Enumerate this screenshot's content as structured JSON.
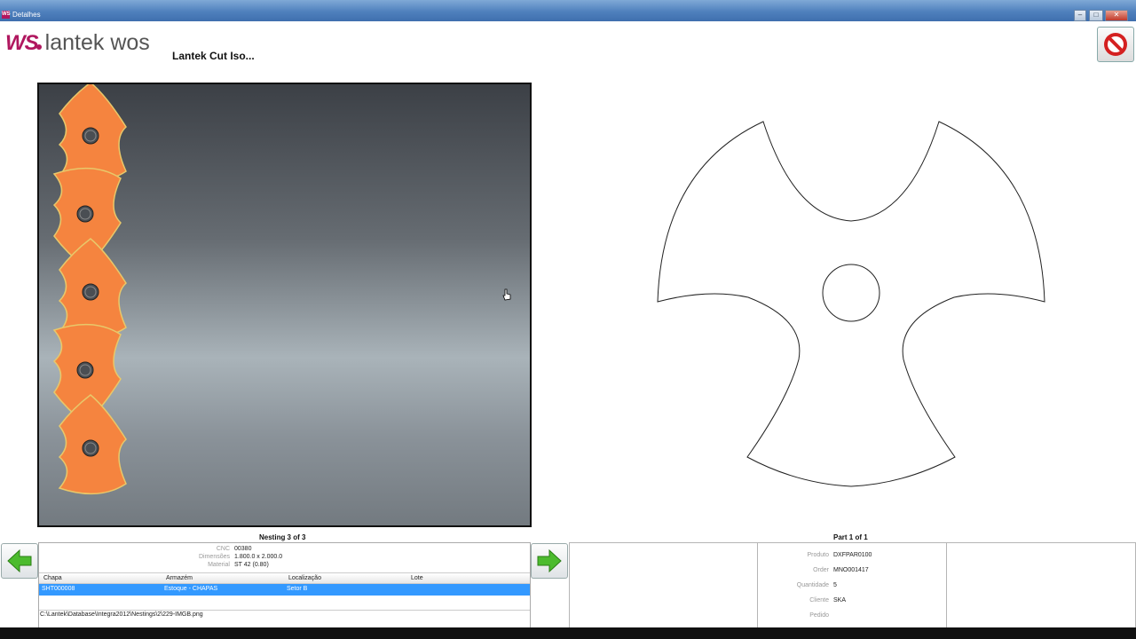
{
  "window": {
    "title": "Detalhes",
    "app_icon_text": "WS"
  },
  "header": {
    "logo_ws": "WS",
    "logo_brand": "lantek wos",
    "module_title": "Lantek Cut Iso..."
  },
  "icons": {
    "stop": "stop-icon",
    "prev": "arrow-left-icon",
    "next": "arrow-right-icon",
    "cursor": "hand-cursor-icon"
  },
  "colors": {
    "part_fill": "#f5843f",
    "part_stroke": "#e8c86a",
    "logo": "#b0175f",
    "selection": "#3399ff"
  },
  "nesting": {
    "caption": "Nesting 3 of 3",
    "cnc_label": "CNC",
    "cnc_value": "00380",
    "dim_label": "Dimensões",
    "dim_value": "1.800.0 x 2.000.0",
    "material_label": "Material",
    "material_value": "ST 42 (0.80)",
    "columns": [
      "Chapa",
      "Armazém",
      "Localização",
      "Lote"
    ],
    "row": {
      "chapa": "SHT000008",
      "armazem": "Estoque - CHAPAS",
      "localizacao": "Setor B",
      "lote": ""
    },
    "path": "C:\\Lantek\\Database\\Integra2012\\Nestings\\2\\229-IMGB.png"
  },
  "part": {
    "caption": "Part 1 of 1",
    "produto_label": "Produto",
    "produto_value": "DXFPAR0100",
    "order_label": "Order",
    "order_value": "MNO001417",
    "quantidade_label": "Quantidade",
    "quantidade_value": "5",
    "cliente_label": "Cliente",
    "cliente_value": "SKA",
    "pedido_label": "Pedido",
    "pedido_value": ""
  }
}
